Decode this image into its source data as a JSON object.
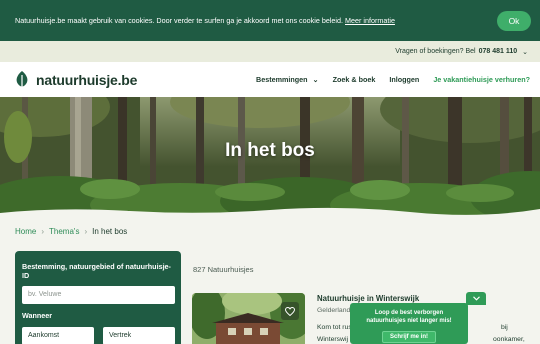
{
  "cookie_bar": {
    "text": "Natuurhuisje.be maakt gebruik van cookies. Door verder te surfen ga je akkoord met ons cookie beleid.",
    "link": "Meer informatie",
    "ok_label": "Ok"
  },
  "phone_bar": {
    "label": "Vragen of boekingen? Bel",
    "number": "078 481 110"
  },
  "header": {
    "brand": "natuurhuisje.be",
    "nav": [
      {
        "label": "Bestemmingen"
      },
      {
        "label": "Zoek & boek"
      },
      {
        "label": "Inloggen"
      },
      {
        "label": "Je vakantiehuisje verhuren?"
      }
    ]
  },
  "hero": {
    "title": "In het bos"
  },
  "breadcrumb": {
    "items": [
      "Home",
      "Thema's",
      "In het bos"
    ]
  },
  "search_panel": {
    "destination_label": "Bestemming, natuurgebied of natuurhuisje-ID",
    "destination_placeholder": "bv. Veluwe",
    "when_label": "Wanneer",
    "arrival_label": "Aankomst",
    "departure_label": "Vertrek"
  },
  "results": {
    "count_text": "827 Natuurhuisjes",
    "first": {
      "title": "Natuurhuisje in Winterswijk",
      "location": "Gelderland",
      "desc_line1": "Kom tot rus",
      "desc_line1_end": "bij",
      "desc_line2": "Winterswij",
      "desc_line2_end": "oonkamer,"
    }
  },
  "popup": {
    "message": "Loop de best verborgen natuurhuisjes niet langer mis!",
    "button": "Schrijf me in!"
  },
  "colors": {
    "dark_green": "#1f5b43",
    "accent_green": "#2f9b57",
    "background": "#f3f4ee"
  }
}
